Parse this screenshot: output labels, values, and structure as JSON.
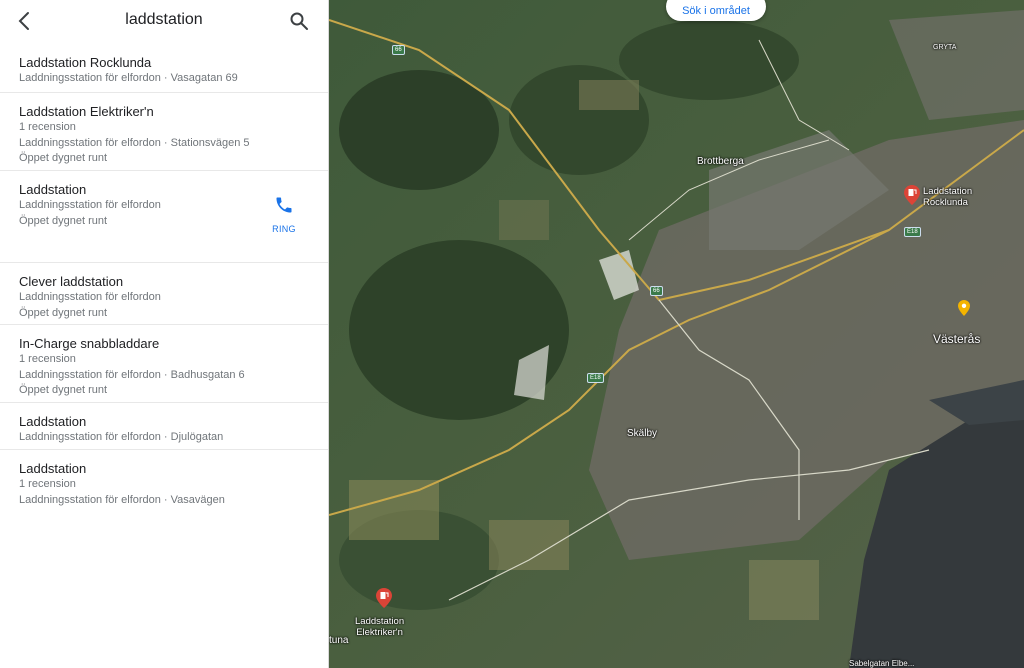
{
  "search": {
    "query": "laddstation"
  },
  "results": [
    {
      "name": "Laddstation Rocklunda",
      "lines": [
        "Laddningsstation för elfordon · Vasagatan 69"
      ]
    },
    {
      "name": "Laddstation Elektriker'n",
      "lines": [
        "1 recension",
        "Laddningsstation för elfordon · Stationsvägen 5",
        "Öppet dygnet runt"
      ]
    },
    {
      "name": "Laddstation",
      "lines": [
        "Laddningsstation för elfordon",
        "Öppet dygnet runt"
      ],
      "action": "RING"
    },
    {
      "name": "Clever laddstation",
      "lines": [
        "Laddningsstation för elfordon",
        "Öppet dygnet runt"
      ]
    },
    {
      "name": "In-Charge snabbladdare",
      "lines": [
        "1 recension",
        "Laddningsstation för elfordon · Badhusgatan 6",
        "Öppet dygnet runt"
      ]
    },
    {
      "name": "Laddstation",
      "lines": [
        "Laddningsstation för elfordon · Djulögatan"
      ]
    },
    {
      "name": "Laddstation",
      "lines": [
        "1 recension",
        "Laddningsstation för elfordon · Vasavägen"
      ]
    }
  ],
  "map": {
    "search_area_button": "Sök i området",
    "place_labels": {
      "gryta": "GRYTA",
      "brottberga": "Brottberga",
      "skalby": "Skälby",
      "vasteras": "Västerås",
      "tuna": "tuna",
      "bottom": "Sabelgatan Elbe..."
    },
    "road_shields": {
      "r66_north": "66",
      "r66_south": "66",
      "e18_west": "E18",
      "e18_east": "E18"
    },
    "pins": {
      "rocklunda": {
        "line1": "Laddstation",
        "line2": "Rocklunda"
      },
      "elektrikern": {
        "line1": "Laddstation",
        "line2": "Elektriker'n"
      }
    }
  },
  "colors": {
    "accent": "#1a73e8",
    "pin_red": "#db4437",
    "marker_yellow": "#f4b400",
    "water": "#34393c"
  }
}
